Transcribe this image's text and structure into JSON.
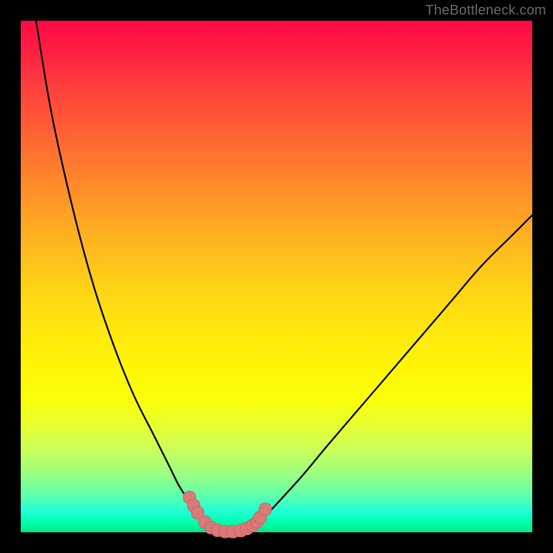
{
  "watermark": "TheBottleneck.com",
  "colors": {
    "frame": "#000000",
    "curve": "#000000",
    "marker_fill": "#d97a78",
    "marker_stroke": "#c76561"
  },
  "chart_data": {
    "type": "line",
    "title": "",
    "xlabel": "",
    "ylabel": "",
    "xlim": [
      0,
      100
    ],
    "ylim": [
      0,
      100
    ],
    "grid": false,
    "legend": false,
    "series": [
      {
        "name": "left-branch",
        "x": [
          3,
          6,
          10,
          14,
          18,
          22,
          26,
          29,
          31,
          33,
          34,
          35,
          36,
          37,
          38
        ],
        "y": [
          100,
          82,
          64,
          49,
          37,
          27,
          19,
          13,
          9,
          6,
          4.5,
          3.2,
          2.1,
          1.2,
          0.6
        ]
      },
      {
        "name": "valley-floor",
        "x": [
          38,
          39,
          40,
          41,
          42,
          43,
          44,
          45
        ],
        "y": [
          0.6,
          0.25,
          0.1,
          0.05,
          0.08,
          0.2,
          0.5,
          1.0
        ]
      },
      {
        "name": "right-branch",
        "x": [
          45,
          47,
          50,
          55,
          60,
          66,
          72,
          78,
          84,
          90,
          96,
          100
        ],
        "y": [
          1.0,
          2.4,
          5.5,
          11,
          17,
          24,
          31,
          38,
          45,
          52,
          58,
          62
        ]
      }
    ],
    "markers": [
      {
        "x": 33.0,
        "y": 6.8
      },
      {
        "x": 33.8,
        "y": 5.2
      },
      {
        "x": 34.6,
        "y": 3.8
      },
      {
        "x": 36.0,
        "y": 2.0
      },
      {
        "x": 37.2,
        "y": 0.9
      },
      {
        "x": 38.5,
        "y": 0.35
      },
      {
        "x": 40.0,
        "y": 0.12
      },
      {
        "x": 41.5,
        "y": 0.1
      },
      {
        "x": 43.0,
        "y": 0.3
      },
      {
        "x": 44.2,
        "y": 0.7
      },
      {
        "x": 45.3,
        "y": 1.3
      },
      {
        "x": 46.2,
        "y": 2.0
      },
      {
        "x": 46.8,
        "y": 2.9
      },
      {
        "x": 47.8,
        "y": 4.5
      }
    ]
  }
}
